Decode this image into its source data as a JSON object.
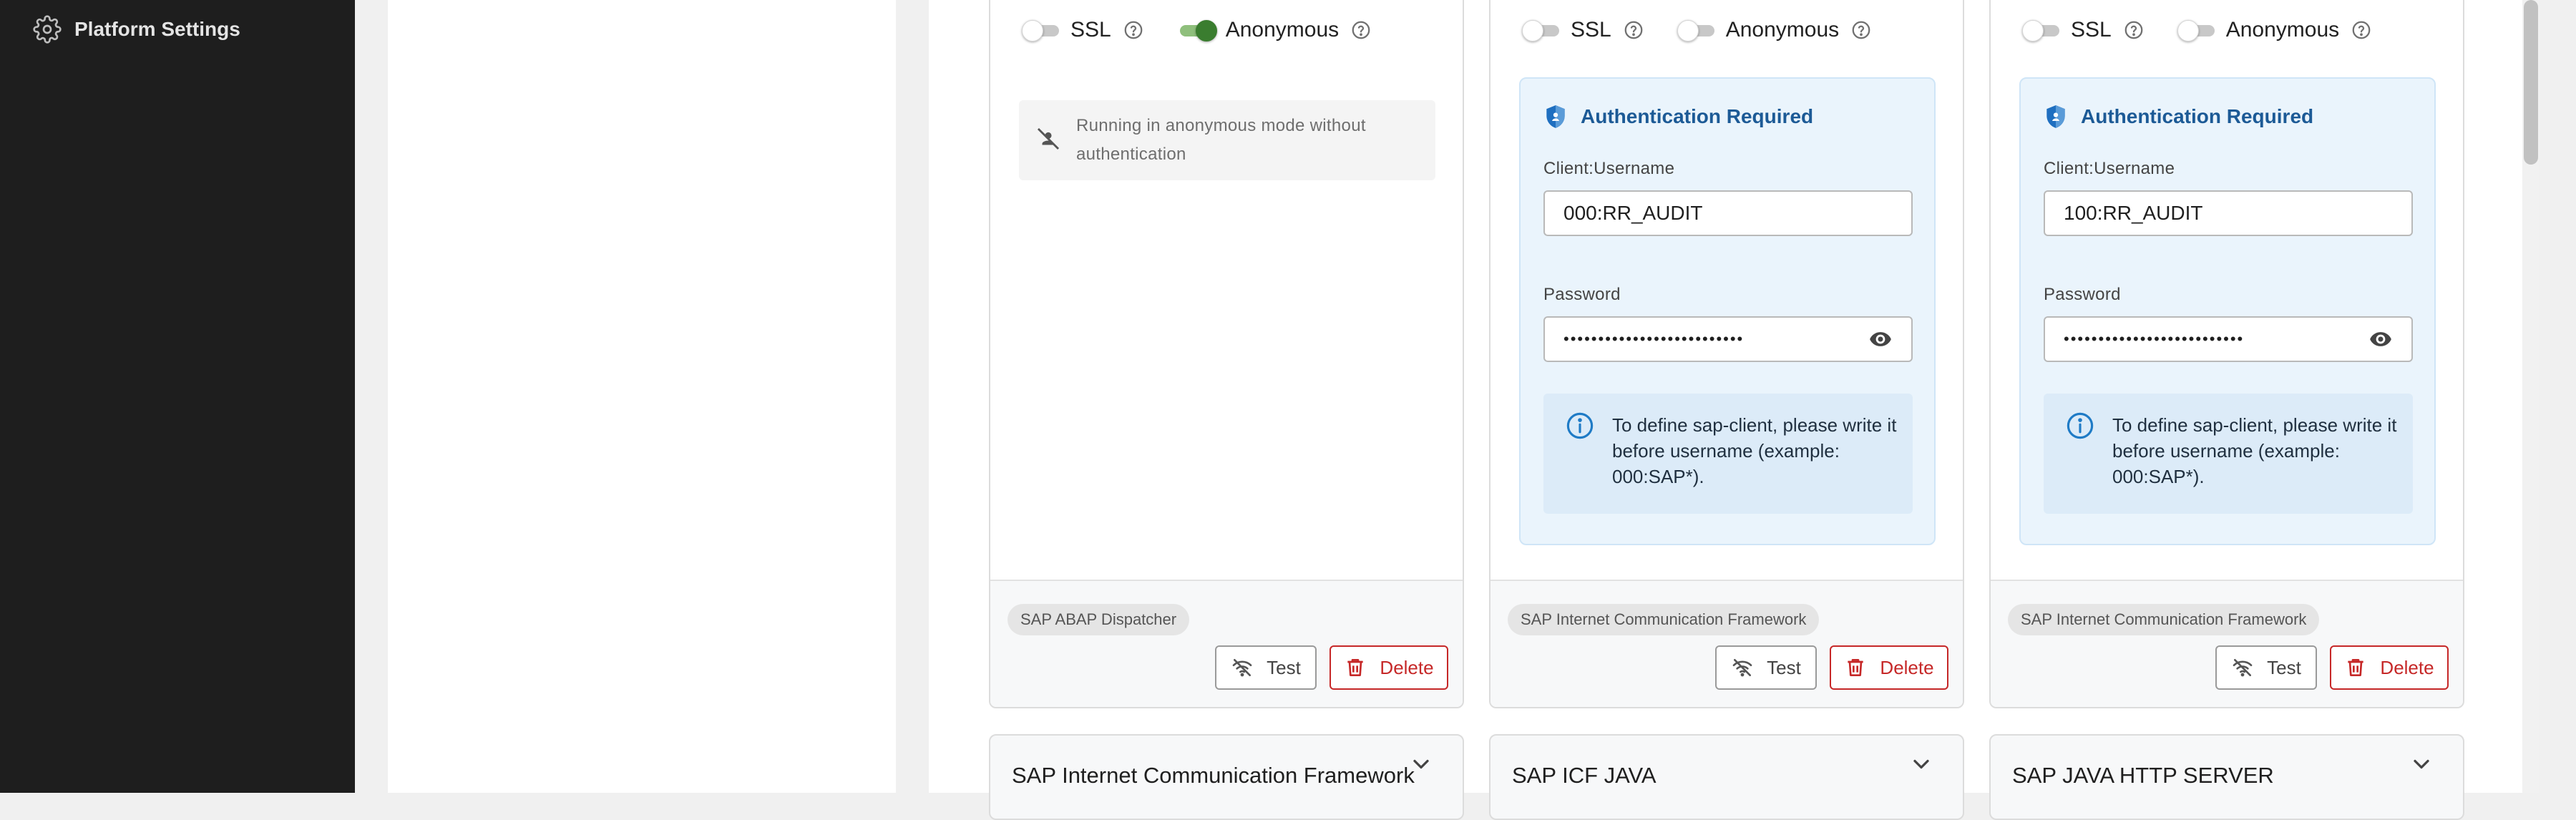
{
  "sidebar": {
    "item": {
      "label": "Platform Settings",
      "icon": "gear-icon"
    }
  },
  "cards": [
    {
      "ssl_label": "SSL",
      "ssl_enabled": false,
      "anonymous_label": "Anonymous",
      "anonymous_enabled": true,
      "anon_notice": "Running in anonymous mode without authentication",
      "protocol_chip": "SAP ABAP Dispatcher",
      "test_label": "Test",
      "delete_label": "Delete"
    },
    {
      "ssl_label": "SSL",
      "ssl_enabled": false,
      "anonymous_label": "Anonymous",
      "anonymous_enabled": false,
      "auth_title": "Authentication Required",
      "username_label": "Client:Username",
      "username_value": "000:RR_AUDIT",
      "password_label": "Password",
      "password_value": "••••••••••••••••••••••••••",
      "info_text": "To define sap-client, please write it before username (example: 000:SAP*).",
      "protocol_chip": "SAP Internet Communication Framework",
      "test_label": "Test",
      "delete_label": "Delete"
    },
    {
      "ssl_label": "SSL",
      "ssl_enabled": false,
      "anonymous_label": "Anonymous",
      "anonymous_enabled": false,
      "auth_title": "Authentication Required",
      "username_label": "Client:Username",
      "username_value": "100:RR_AUDIT",
      "password_label": "Password",
      "password_value": "••••••••••••••••••••••••••",
      "info_text": "To define sap-client, please write it before username (example: 000:SAP*).",
      "protocol_chip": "SAP Internet Communication Framework",
      "test_label": "Test",
      "delete_label": "Delete"
    }
  ],
  "collapsed_cards": [
    {
      "title": "SAP Internet Communication Framework"
    },
    {
      "title": "SAP ICF JAVA"
    },
    {
      "title": "SAP JAVA HTTP SERVER"
    }
  ],
  "colors": {
    "sidebar_bg": "#1e1e1e",
    "toggle_on": "#3a7d2f",
    "auth_title": "#1c5a96",
    "info_icon": "#1f7bc6",
    "delete": "#c62828"
  }
}
